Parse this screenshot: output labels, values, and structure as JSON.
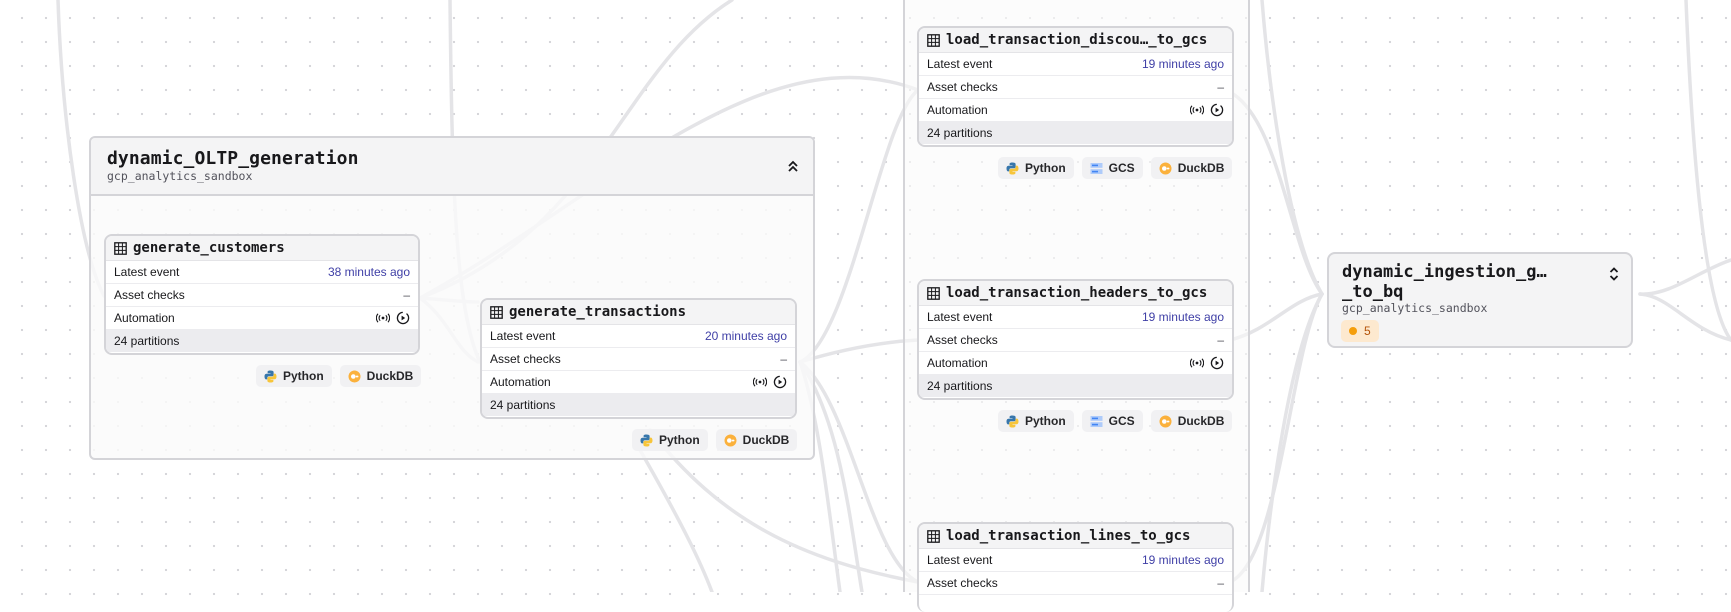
{
  "groups": {
    "oltp": {
      "title": "dynamic_OLTP_generation",
      "subtitle": "gcp_analytics_sandbox"
    },
    "ingestion": {
      "title": "dynamic_ingestion_g…\n_to_bq",
      "title_line1": "dynamic_ingestion_g…",
      "title_line2": "_to_bq",
      "subtitle": "gcp_analytics_sandbox",
      "badge_count": "5"
    }
  },
  "labels": {
    "latest_event": "Latest event",
    "asset_checks": "Asset checks",
    "automation": "Automation",
    "dash": "–"
  },
  "assets": {
    "generate_customers": {
      "name": "generate_customers",
      "latest": "38 minutes ago",
      "partitions": "24 partitions"
    },
    "generate_transactions": {
      "name": "generate_transactions",
      "latest": "20 minutes ago",
      "partitions": "24 partitions"
    },
    "load_discounts": {
      "name": "load_transaction_discou…_to_gcs",
      "latest": "19 minutes ago",
      "partitions": "24 partitions"
    },
    "load_headers": {
      "name": "load_transaction_headers_to_gcs",
      "latest": "19 minutes ago",
      "partitions": "24 partitions"
    },
    "load_lines": {
      "name": "load_transaction_lines_to_gcs",
      "latest": "19 minutes ago"
    }
  },
  "tags": {
    "python": "Python",
    "duckdb": "DuckDB",
    "gcs": "GCS"
  },
  "colors": {
    "edge": "#e4e4e7",
    "border": "#d4d4d8",
    "link": "#3f3fa6",
    "badge": "#f59e0b"
  }
}
